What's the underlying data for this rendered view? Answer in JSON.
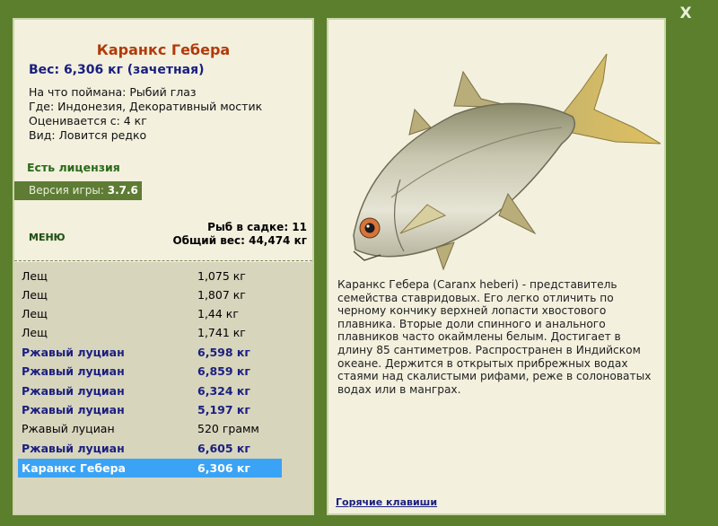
{
  "close_label": "X",
  "fish": {
    "title": "Каранкс Гебера",
    "weight_line": "Вес: 6,306 кг (зачетная)",
    "details": [
      "На что поймана: Рыбий глаз",
      "Где: Индонезия, Декоративный мостик",
      "Оценивается с: 4 кг",
      "Вид: Ловится редко"
    ],
    "license": "Есть лицензия",
    "version_label": "Версия игры:",
    "version_value": "3.7.6"
  },
  "menu_label": "МЕНЮ",
  "counts": {
    "fish_in_net": "Рыб в садке: 11",
    "total_weight": "Общий вес: 44,474 кг"
  },
  "catch_list": [
    {
      "name": "Лещ",
      "weight": "1,075 кг",
      "bold": false
    },
    {
      "name": "Лещ",
      "weight": "1,807 кг",
      "bold": false
    },
    {
      "name": "Лещ",
      "weight": "1,44 кг",
      "bold": false
    },
    {
      "name": "Лещ",
      "weight": "1,741 кг",
      "bold": false
    },
    {
      "name": "Ржавый луциан",
      "weight": "6,598 кг",
      "bold": true
    },
    {
      "name": "Ржавый луциан",
      "weight": "6,859 кг",
      "bold": true
    },
    {
      "name": "Ржавый луциан",
      "weight": "6,324 кг",
      "bold": true
    },
    {
      "name": "Ржавый луциан",
      "weight": "5,197 кг",
      "bold": true
    },
    {
      "name": "Ржавый луциан",
      "weight": "520 грамм",
      "bold": false
    },
    {
      "name": "Ржавый луциан",
      "weight": "6,605 кг",
      "bold": true
    },
    {
      "name": "Каранкс Гебера",
      "weight": "6,306 кг",
      "bold": true,
      "selected": true
    }
  ],
  "description": "Каранкс Гебера (Caranx heberi) - представитель семейства ставридовых. Его легко отличить по черному кончику верхней лопасти хвостового плавника. Вторые доли спинного и анального плавников часто окаймлены белым. Достигает в длину 85 сантиметров. Распространен в Индийском океане. Держится в открытых прибрежных водах стаями над скалистыми рифами, реже в солоноватых водах или в манграх.",
  "hotkeys_label": "Горячие клавиши",
  "colors": {
    "background": "#5b7f2c",
    "panel": "#f3f0de",
    "list_bg": "#d8d5bd",
    "title": "#b23a0a",
    "accent_blue": "#1a1f80",
    "selected_row": "#3aa3f5"
  }
}
